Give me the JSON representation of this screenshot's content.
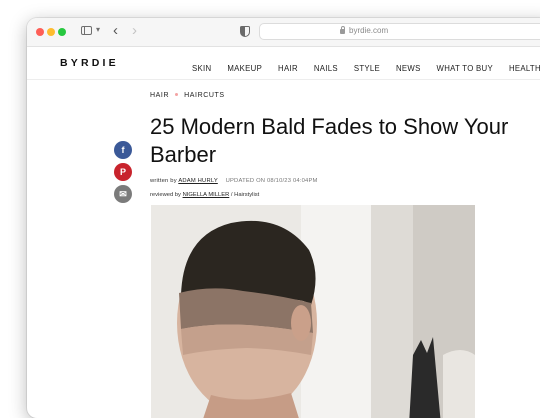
{
  "browser": {
    "url": "byrdie.com",
    "icons": [
      "sidebar-toggle-icon",
      "chevron-down-icon",
      "back-arrow-icon",
      "forward-arrow-icon",
      "shield-icon",
      "lock-icon"
    ]
  },
  "site": {
    "logo": "BYRDIE",
    "nav": [
      "SKIN",
      "MAKEUP",
      "HAIR",
      "NAILS",
      "STYLE",
      "NEWS",
      "WHAT TO BUY",
      "HEALTH AND W"
    ]
  },
  "article": {
    "breadcrumb": [
      "HAIR",
      "HAIRCUTS"
    ],
    "title": "25 Modern Bald Fades to Show Your Barber",
    "written_by_prefix": "written by",
    "author": "ADAM HURLY",
    "updated": "UPDATED ON 08/10/23 04:04PM",
    "reviewed_by_prefix": "reviewed by",
    "reviewer": "NIGELLA MILLER",
    "reviewer_role": "/ Hairstylist"
  },
  "share": {
    "facebook_glyph": "f",
    "pinterest_glyph": "P",
    "email_glyph": "✉"
  },
  "colors": {
    "facebook": "#3b5998",
    "pinterest": "#c8232c",
    "email": "#7b7b7b",
    "breadcrumb_dot": "#f3a3a3"
  }
}
